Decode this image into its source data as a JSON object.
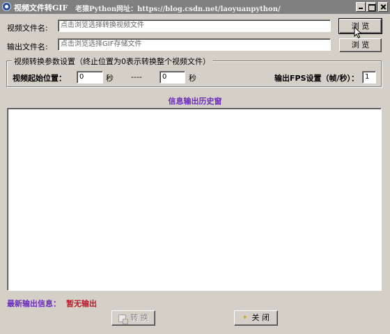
{
  "window": {
    "title": "视频文件转GIF",
    "subtitle": "老猿Python网址：https://blog.csdn.net/laoyuanpython/"
  },
  "input_file": {
    "label": "视频文件名:",
    "placeholder": "点击浏览选择转换视频文件",
    "browse_label": "浏 览"
  },
  "output_file": {
    "label": "输出文件名:",
    "placeholder": "点击浏览选择GIF存储文件",
    "browse_label": "浏 览"
  },
  "params": {
    "legend": "视频转换参数设置（终止位置为0表示转换整个视频文件）",
    "start_label": "视频起始位置：",
    "start_value": "0",
    "start_unit": "秒",
    "separator": "----",
    "end_value": "0",
    "end_unit": "秒",
    "fps_label": "输出FPS设置（帧/秒）：",
    "fps_value": "1"
  },
  "history": {
    "title": "信息输出历史窗"
  },
  "status": {
    "label": "最新输出信息：",
    "value": "暂无输出"
  },
  "buttons": {
    "convert": "转 换",
    "close": "关 闭"
  },
  "icons": {
    "app": "app-icon",
    "convert": "convert-icon",
    "close": "star-icon"
  },
  "colors": {
    "titlebar": "#808080",
    "accent_purple": "#6a2cb8",
    "status_red": "#c0182c",
    "face": "#d4d0c8"
  }
}
